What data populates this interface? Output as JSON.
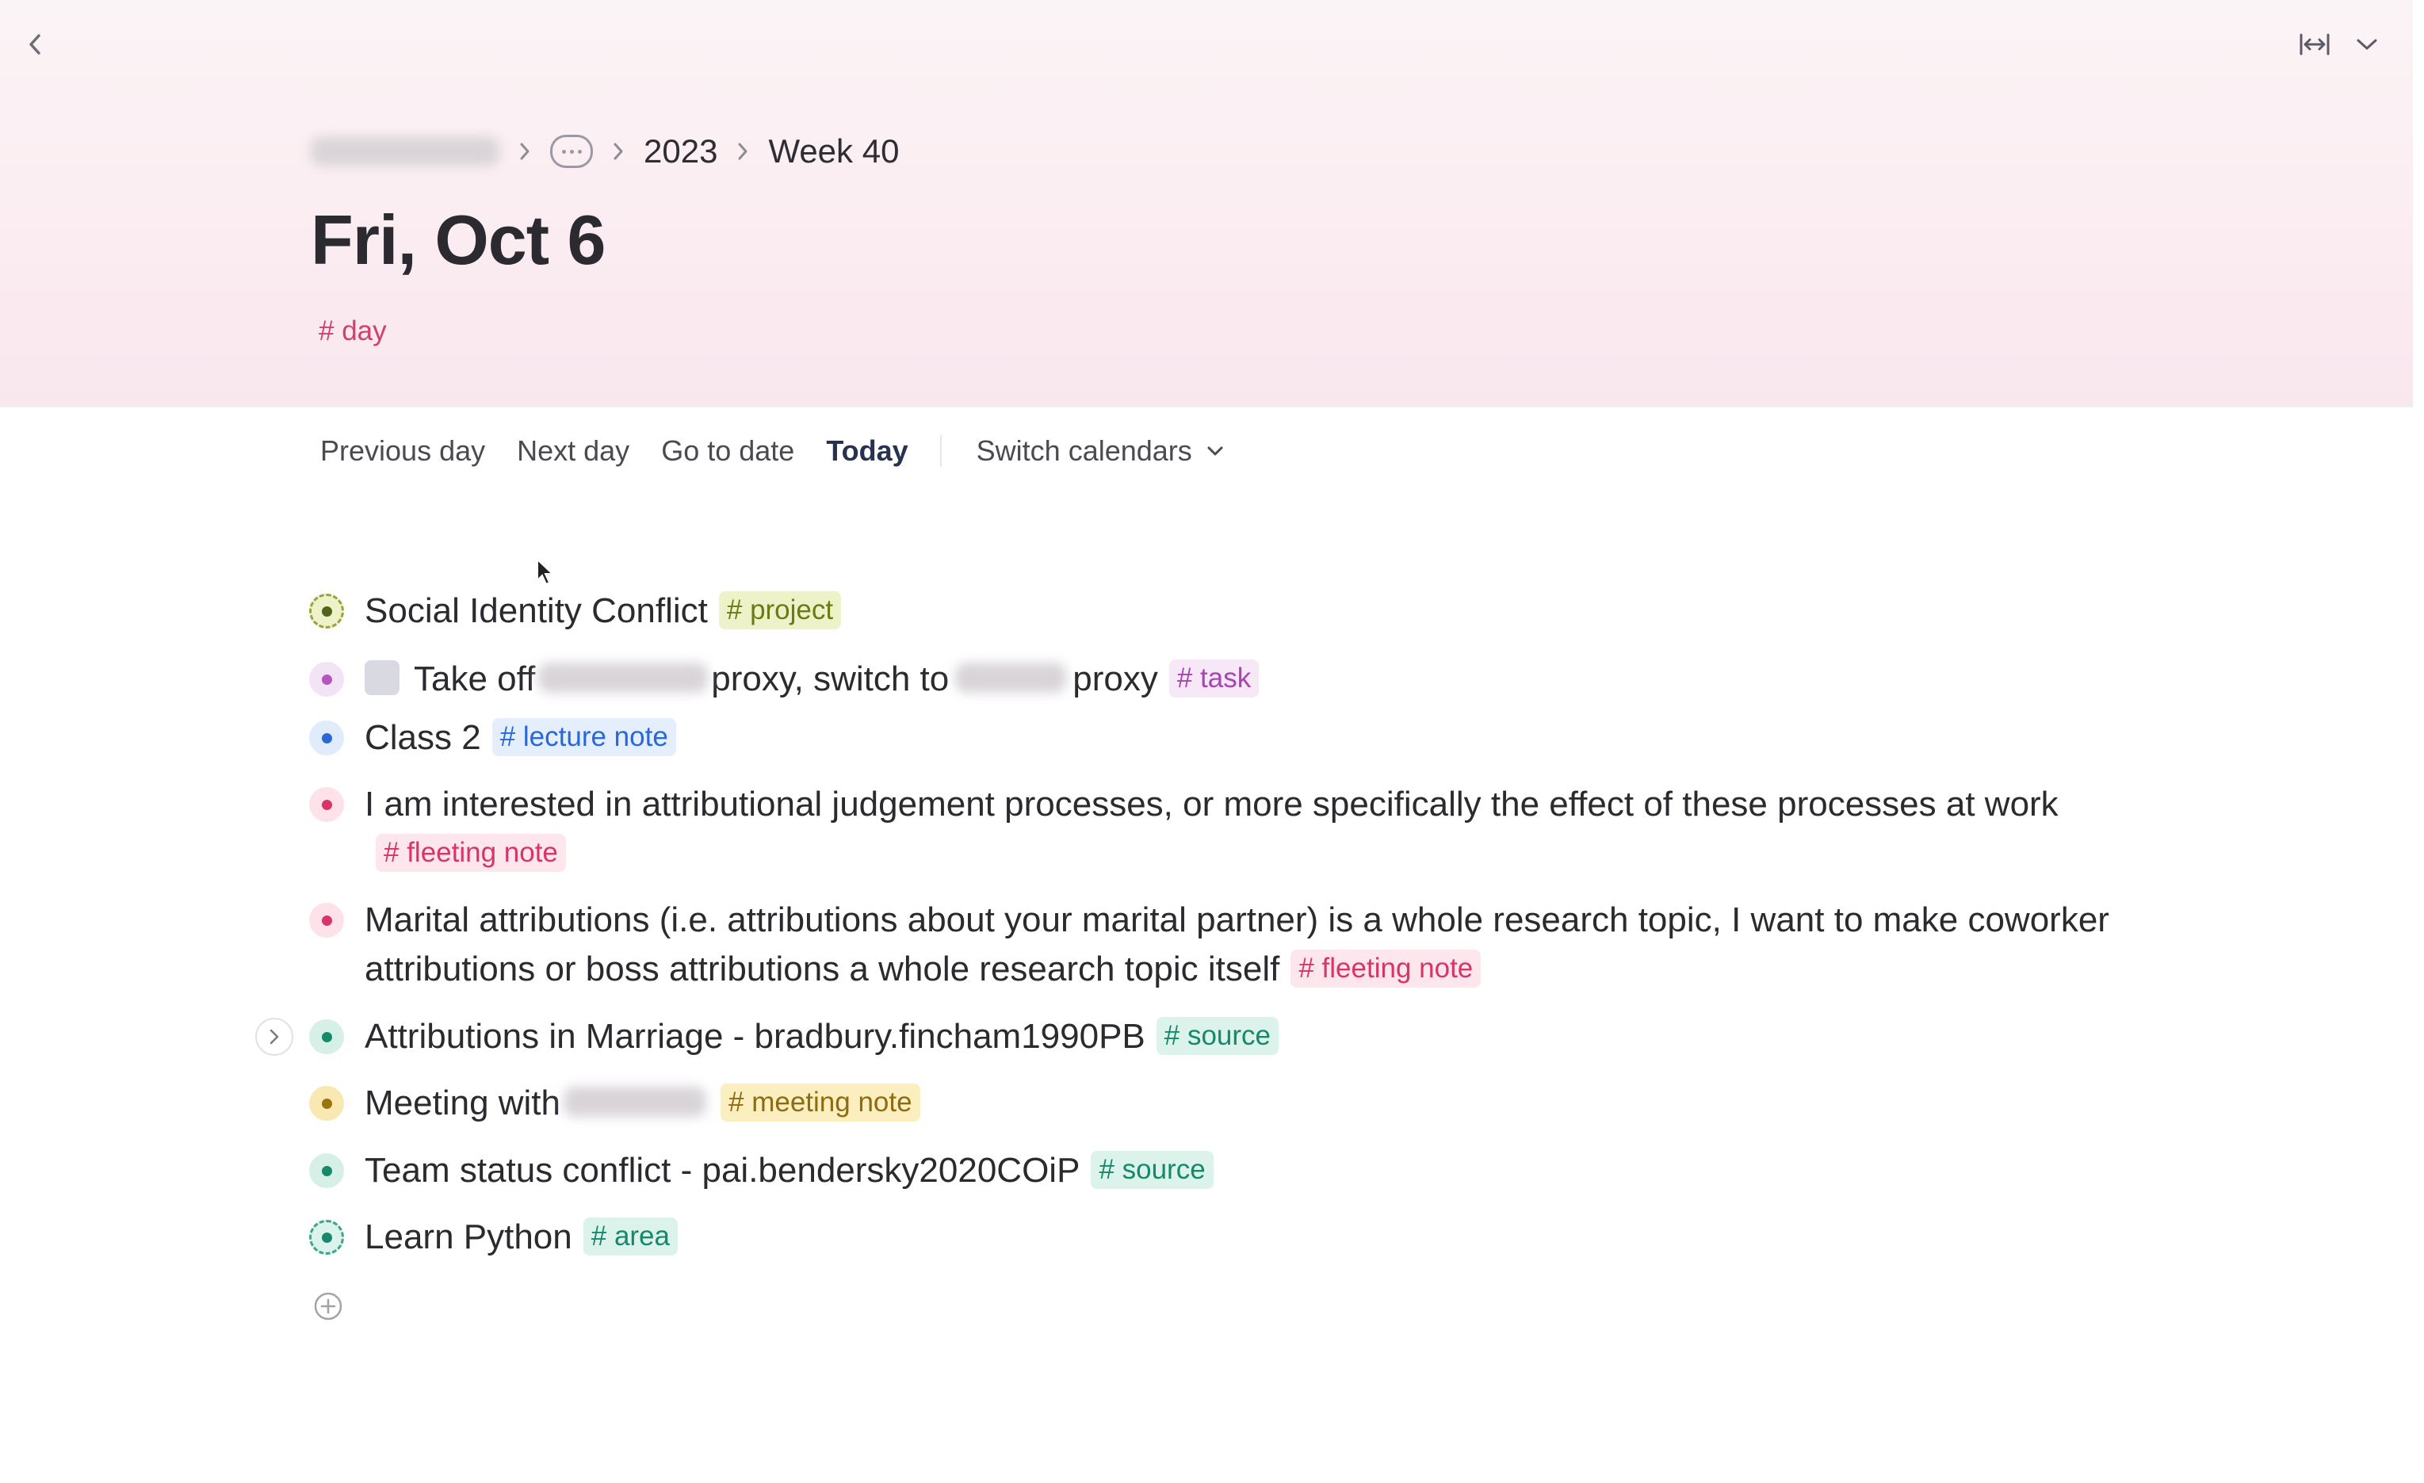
{
  "breadcrumb": {
    "year": "2023",
    "week": "Week 40"
  },
  "page": {
    "title": "Fri, Oct 6",
    "tag": "# day"
  },
  "nav": {
    "previous": "Previous day",
    "next": "Next day",
    "goto": "Go to date",
    "today": "Today",
    "switch": "Switch calendars"
  },
  "items": [
    {
      "text": "Social Identity Conflict",
      "tag": "# project",
      "color": "#6b7a15"
    },
    {
      "before": "Take off",
      "middle": "proxy, switch to",
      "after": "proxy",
      "tag": "# task",
      "color": "#b455c0"
    },
    {
      "text": "Class 2",
      "tag": "# lecture note",
      "color": "#2a68d8"
    },
    {
      "text": "I am interested in attributional judgement processes, or more specifically the effect of these processes at work",
      "tag": "# fleeting note",
      "color": "#d8346a"
    },
    {
      "text": "Marital attributions (i.e. attributions about your marital partner) is a whole research topic, I want to make coworker attributions or boss attributions a whole research topic itself",
      "tag": "# fleeting note",
      "color": "#d8346a"
    },
    {
      "text": "Attributions in Marriage - bradbury.fincham1990PB",
      "tag": "# source",
      "color": "#16896a"
    },
    {
      "text": "Meeting with",
      "tag": "# meeting note",
      "color": "#8e6b10"
    },
    {
      "text": "Team status conflict - pai.bendersky2020COiP",
      "tag": "# source",
      "color": "#16896a"
    },
    {
      "text": "Learn Python",
      "tag": "# area",
      "color": "#16896a"
    }
  ]
}
